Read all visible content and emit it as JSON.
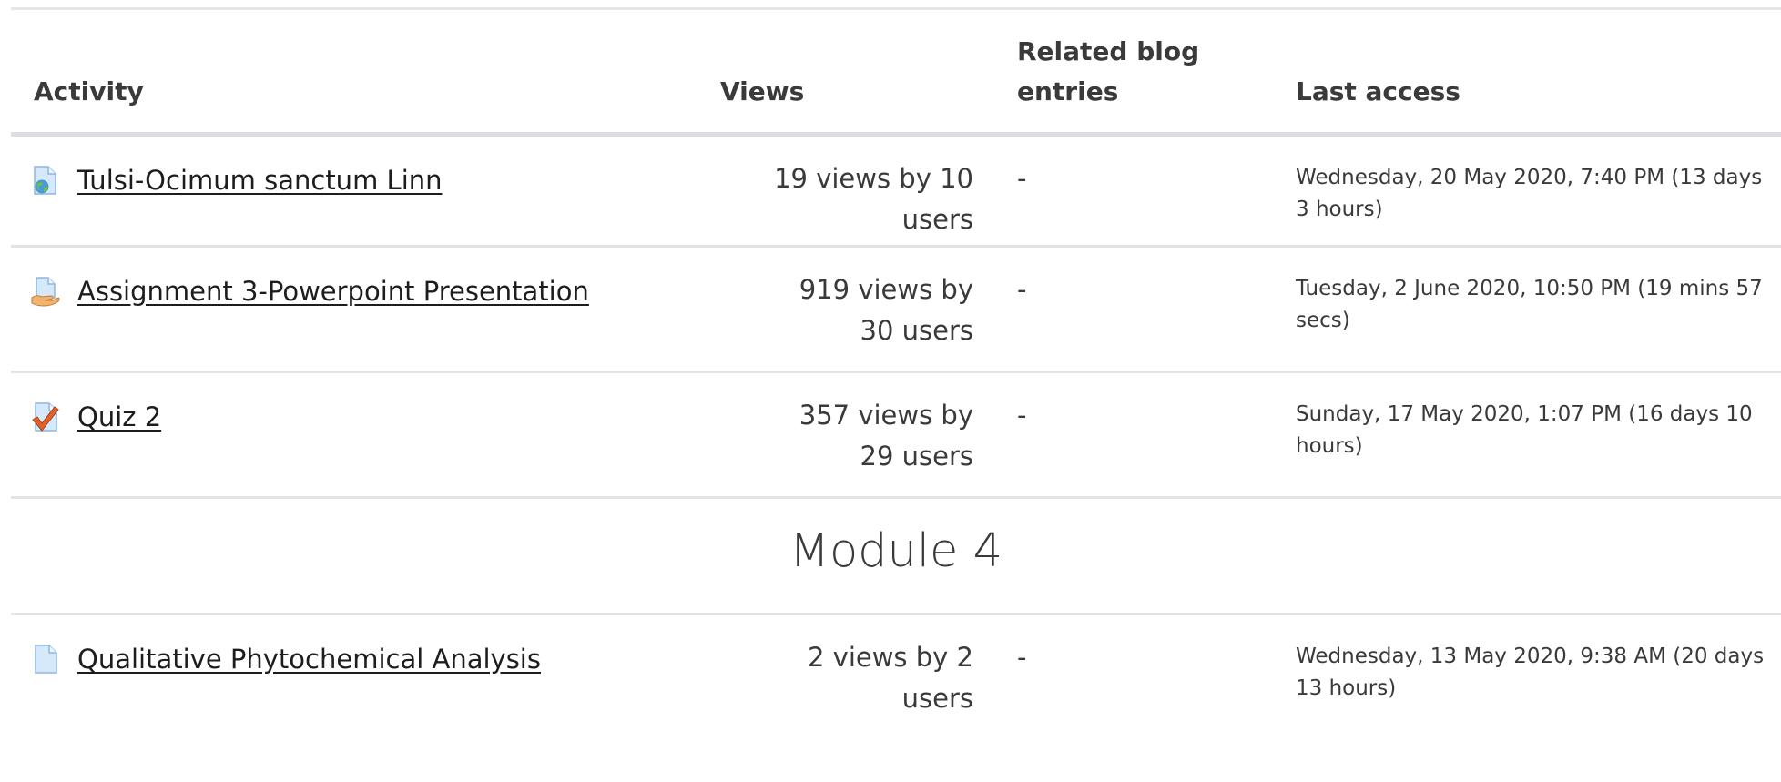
{
  "table": {
    "headers": {
      "activity": "Activity",
      "views": "Views",
      "blog": "Related blog entries",
      "last_access": "Last access"
    },
    "rows": [
      {
        "icon": "url-icon",
        "activity": "Tulsi-Ocimum sanctum Linn",
        "views": "19 views by 10 users",
        "blog": "-",
        "last_access": "Wednesday, 20 May 2020, 7:40 PM (13 days 3 hours)"
      },
      {
        "icon": "assignment-icon",
        "activity": "Assignment 3-Powerpoint Presentation",
        "views": "919 views by 30 users",
        "blog": "-",
        "last_access": "Tuesday, 2 June 2020, 10:50 PM (19 mins 57 secs)"
      },
      {
        "icon": "quiz-icon",
        "activity": "Quiz 2",
        "views": "357 views by 29 users",
        "blog": "-",
        "last_access": "Sunday, 17 May 2020, 1:07 PM (16 days 10 hours)"
      }
    ],
    "section": {
      "title": "Module 4"
    },
    "rows_after_section": [
      {
        "icon": "page-icon",
        "activity": "Qualitative Phytochemical Analysis",
        "views": "2 views by 2 users",
        "blog": "-",
        "last_access": "Wednesday, 13 May 2020, 9:38 AM (20 days 13 hours)"
      }
    ]
  },
  "colors": {
    "text": "#3a3a3a",
    "link": "#1d1d1d",
    "rule": "#e3e3e7",
    "header_rule": "#dedde6"
  }
}
